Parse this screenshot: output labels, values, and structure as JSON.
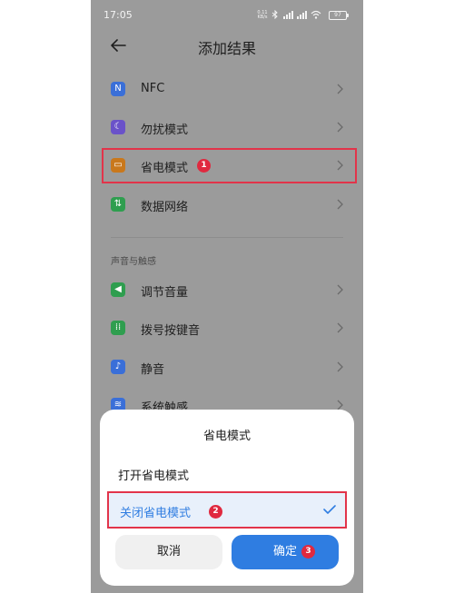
{
  "status_bar": {
    "time": "17:05",
    "net_speed": "0.11 KB/s",
    "battery": "97"
  },
  "header": {
    "title": "添加结果"
  },
  "list": {
    "items": [
      {
        "label": "NFC",
        "icon": "nfc-icon",
        "color": "#3a6fd8"
      },
      {
        "label": "勿扰模式",
        "icon": "moon-icon",
        "color": "#6a52c9"
      },
      {
        "label": "省电模式",
        "icon": "battery-saver-icon",
        "color": "#c9781c"
      },
      {
        "label": "数据网络",
        "icon": "data-network-icon",
        "color": "#2f9e4f"
      }
    ],
    "section_header": "声音与触感",
    "sound_items": [
      {
        "label": "调节音量",
        "icon": "volume-icon",
        "color": "#2f9e4f"
      },
      {
        "label": "拨号按键音",
        "icon": "dialpad-icon",
        "color": "#2f9e4f"
      },
      {
        "label": "静音",
        "icon": "mute-icon",
        "color": "#3a6fd8"
      },
      {
        "label": "系统触感",
        "icon": "vibration-icon",
        "color": "#3a6fd8"
      }
    ]
  },
  "annotations": {
    "badge1": "1",
    "badge2": "2",
    "badge3": "3",
    "color": "#e2344a"
  },
  "sheet": {
    "title": "省电模式",
    "option_on": "打开省电模式",
    "option_off": "关闭省电模式",
    "cancel_label": "取消",
    "ok_label": "确定",
    "accent": "#2f7de1"
  }
}
